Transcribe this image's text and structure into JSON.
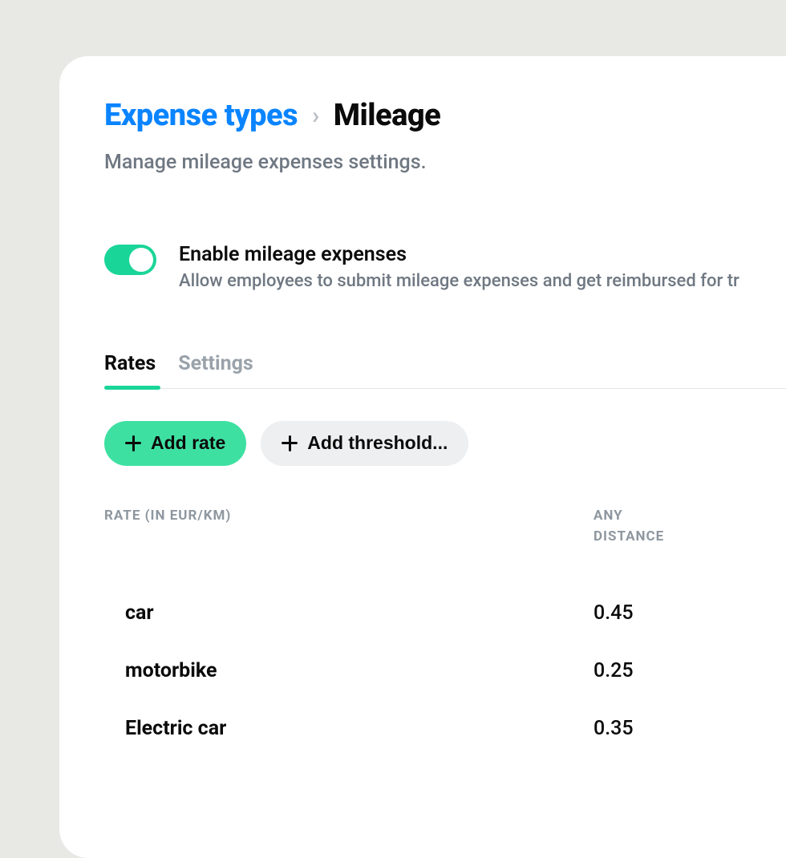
{
  "breadcrumb": {
    "parent": "Expense types",
    "current": "Mileage"
  },
  "subtitle": "Manage mileage expenses settings.",
  "toggle": {
    "enabled": true,
    "title": "Enable mileage expenses",
    "description": "Allow employees to submit mileage expenses and get reimbursed for tr"
  },
  "tabs": [
    {
      "label": "Rates",
      "active": true
    },
    {
      "label": "Settings",
      "active": false
    }
  ],
  "actions": {
    "add_rate": "Add rate",
    "add_threshold": "Add threshold..."
  },
  "table": {
    "header_rate": "RATE (IN EUR/KM)",
    "header_dist_line1": "ANY",
    "header_dist_line2": "DISTANCE",
    "rows": [
      {
        "name": "car",
        "value": "0.45"
      },
      {
        "name": "motorbike",
        "value": "0.25"
      },
      {
        "name": "Electric car",
        "value": "0.35"
      }
    ]
  }
}
